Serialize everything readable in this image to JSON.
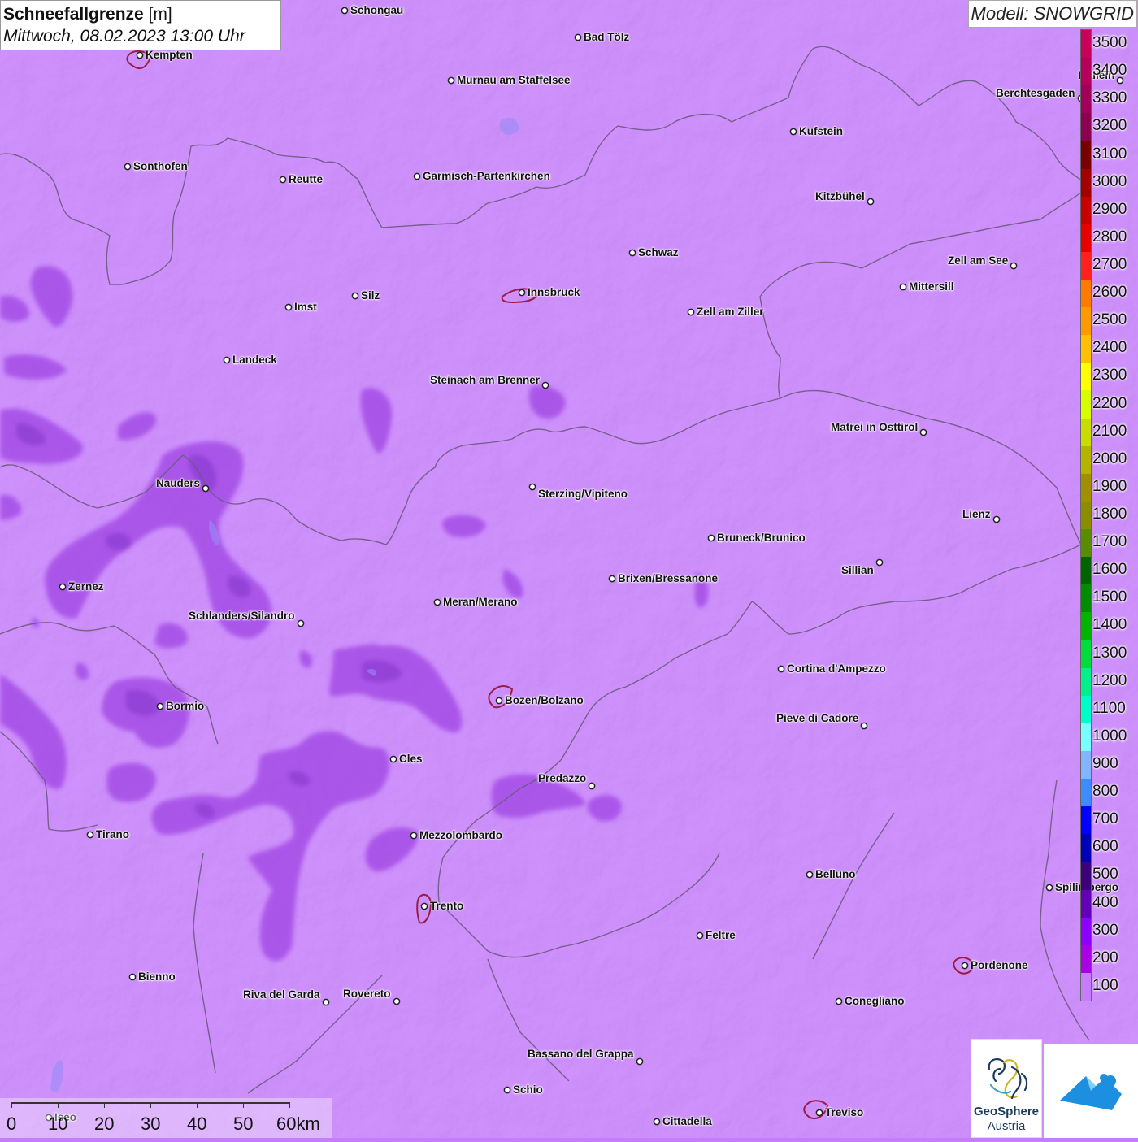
{
  "header": {
    "title": "Schneefallgrenze",
    "unit": "[m]",
    "datetime": "Mittwoch, 08.02.2023 13:00 Uhr",
    "model": "Modell: SNOWGRID"
  },
  "legend": {
    "steps": [
      {
        "label": "3500",
        "color": "#c8005a"
      },
      {
        "label": "3400",
        "color": "#b4005a"
      },
      {
        "label": "3300",
        "color": "#a0005a"
      },
      {
        "label": "3200",
        "color": "#8c0050"
      },
      {
        "label": "3100",
        "color": "#780000"
      },
      {
        "label": "3000",
        "color": "#a00000"
      },
      {
        "label": "2900",
        "color": "#c80000"
      },
      {
        "label": "2800",
        "color": "#e60000"
      },
      {
        "label": "2700",
        "color": "#ff2020"
      },
      {
        "label": "2600",
        "color": "#ff7a00"
      },
      {
        "label": "2500",
        "color": "#ff9a00"
      },
      {
        "label": "2400",
        "color": "#ffc000"
      },
      {
        "label": "2300",
        "color": "#ffff00"
      },
      {
        "label": "2200",
        "color": "#d6ff00"
      },
      {
        "label": "2100",
        "color": "#c8dc00"
      },
      {
        "label": "2000",
        "color": "#b4b400"
      },
      {
        "label": "1900",
        "color": "#a09000"
      },
      {
        "label": "1800",
        "color": "#8c8c00"
      },
      {
        "label": "1700",
        "color": "#5a8c00"
      },
      {
        "label": "1600",
        "color": "#006400"
      },
      {
        "label": "1500",
        "color": "#008c00"
      },
      {
        "label": "1400",
        "color": "#00b400"
      },
      {
        "label": "1300",
        "color": "#00dc3c"
      },
      {
        "label": "1200",
        "color": "#00f08c"
      },
      {
        "label": "1100",
        "color": "#00ffc8"
      },
      {
        "label": "1000",
        "color": "#78ffff"
      },
      {
        "label": "900",
        "color": "#82b4ff"
      },
      {
        "label": "800",
        "color": "#3c8cff"
      },
      {
        "label": "700",
        "color": "#0000ff"
      },
      {
        "label": "600",
        "color": "#0000b4"
      },
      {
        "label": "500",
        "color": "#3c0078"
      },
      {
        "label": "400",
        "color": "#6400b4"
      },
      {
        "label": "300",
        "color": "#8c00ff"
      },
      {
        "label": "200",
        "color": "#aa00e6"
      },
      {
        "label": "100",
        "color": "#c77cff"
      }
    ]
  },
  "places": [
    {
      "name": "Schongau"
    },
    {
      "name": "Bad Tölz"
    },
    {
      "name": "Kempten"
    },
    {
      "name": "Murnau am Staffelsee"
    },
    {
      "name": "Hallein"
    },
    {
      "name": "Berchtesgaden"
    },
    {
      "name": "Kufstein"
    },
    {
      "name": "Sonthofen"
    },
    {
      "name": "Reutte"
    },
    {
      "name": "Garmisch-Partenkirchen"
    },
    {
      "name": "Kitzbühel"
    },
    {
      "name": "Schwaz"
    },
    {
      "name": "Zell am See"
    },
    {
      "name": "Mittersill"
    },
    {
      "name": "Innsbruck"
    },
    {
      "name": "Silz"
    },
    {
      "name": "Imst"
    },
    {
      "name": "Zell am Ziller"
    },
    {
      "name": "Landeck"
    },
    {
      "name": "Steinach am Brenner"
    },
    {
      "name": "Matrei in Osttirol"
    },
    {
      "name": "Nauders"
    },
    {
      "name": "Sterzing/Vipiteno"
    },
    {
      "name": "Lienz"
    },
    {
      "name": "Bruneck/Brunico"
    },
    {
      "name": "Sillian"
    },
    {
      "name": "Brixen/Bressanone"
    },
    {
      "name": "Zernez"
    },
    {
      "name": "Meran/Merano"
    },
    {
      "name": "Schlanders/Silandro"
    },
    {
      "name": "Cortina d'Ampezzo"
    },
    {
      "name": "Bozen/Bolzano"
    },
    {
      "name": "Bormio"
    },
    {
      "name": "Pieve di Cadore"
    },
    {
      "name": "Cles"
    },
    {
      "name": "Predazzo"
    },
    {
      "name": "Tirano"
    },
    {
      "name": "Mezzolombardo"
    },
    {
      "name": "Belluno"
    },
    {
      "name": "Spilimbergo"
    },
    {
      "name": "Trento"
    },
    {
      "name": "Feltre"
    },
    {
      "name": "Pordenone"
    },
    {
      "name": "Bienno"
    },
    {
      "name": "Riva del Garda"
    },
    {
      "name": "Rovereto"
    },
    {
      "name": "Conegliano"
    },
    {
      "name": "Bassano del Grappa"
    },
    {
      "name": "Schio"
    },
    {
      "name": "Treviso"
    },
    {
      "name": "Cittadella"
    },
    {
      "name": "Iseo"
    }
  ],
  "scale": {
    "labels": [
      "0",
      "10",
      "20",
      "30",
      "40",
      "50",
      "60km"
    ]
  },
  "logos": {
    "geosphere_line1": "GeoSphere",
    "geosphere_line2": "Austria"
  }
}
